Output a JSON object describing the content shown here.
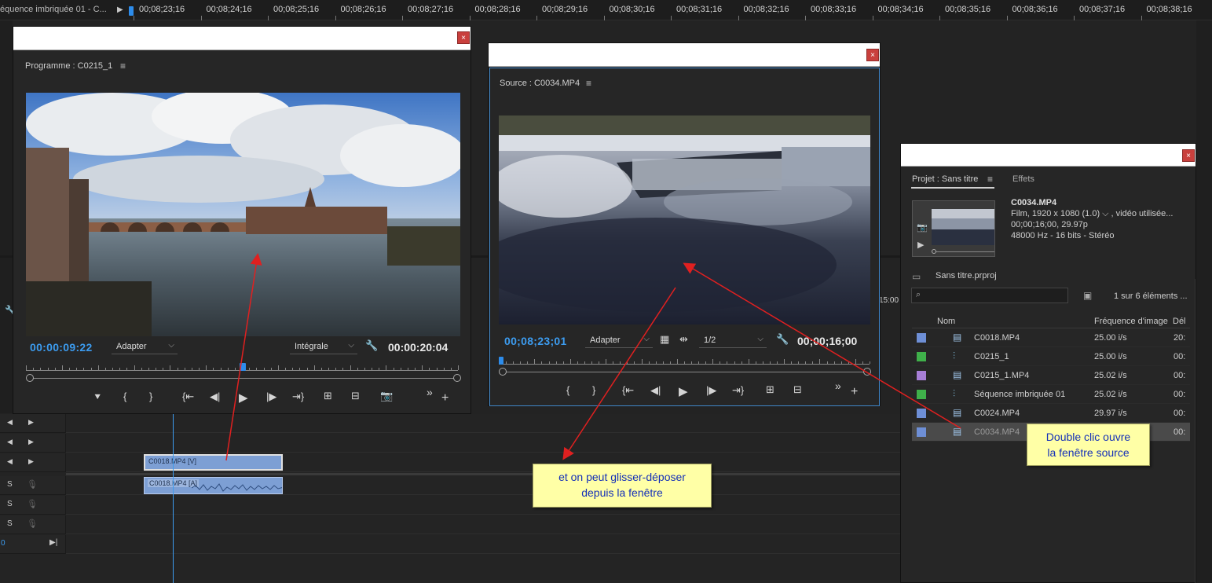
{
  "top_ruler": {
    "sequence_label": "équence imbriquée 01 - C...",
    "ticks": [
      "00;08;23;16",
      "00;08;24;16",
      "00;08;25;16",
      "00;08;26;16",
      "00;08;27;16",
      "00;08;28;16",
      "00;08;29;16",
      "00;08;30;16",
      "00;08;31;16",
      "00;08;32;16",
      "00;08;33;16",
      "00;08;34;16",
      "00;08;35;16",
      "00;08;36;16",
      "00;08;37;16",
      "00;08;38;16"
    ]
  },
  "program_monitor": {
    "title": "Programme : C0215_1",
    "close": "×",
    "menu": "≡",
    "current_timecode": "00:00:09:22",
    "fit_dropdown": "Adapter",
    "quality_dropdown": "Intégrale",
    "duration_timecode": "00:00:20:04",
    "more": "»",
    "add": "+",
    "playhead_fraction": 0.5
  },
  "source_monitor": {
    "title": "Source : C0034.MP4",
    "close": "×",
    "menu": "≡",
    "current_timecode": "00;08;23;01",
    "fit_dropdown": "Adapter",
    "resolution_dropdown": "1/2",
    "duration_timecode": "00;00;16;00",
    "more": "»",
    "add": "+",
    "playhead_fraction": 0.0
  },
  "project_panel": {
    "tab_project": "Projet : Sans titre",
    "tab_menu": "≡",
    "tab_effects": "Effets",
    "close": "×",
    "preview": {
      "name": "C0034.MP4",
      "line1": "Film, 1920 x 1080 (1.0) ⌵ , vidéo utilisée...",
      "line2": "00;00;16;00, 29.97p",
      "line3": "48000 Hz - 16  bits - Stéréo"
    },
    "project_file": "Sans titre.prproj",
    "search_placeholder": "",
    "item_count": "1 sur 6 éléments ...",
    "columns": {
      "name": "Nom",
      "framerate": "Fréquence d'image",
      "extra": "Dél"
    },
    "items": [
      {
        "name": "C0018.MP4",
        "framerate": "25.00 i/s",
        "extra": "20:",
        "color": "#6e8fd6",
        "type": "clip"
      },
      {
        "name": "C0215_1",
        "framerate": "25.00 i/s",
        "extra": "00:",
        "color": "#3fb04a",
        "type": "sequence"
      },
      {
        "name": "C0215_1.MP4",
        "framerate": "25.02 i/s",
        "extra": "00:",
        "color": "#a77ed6",
        "type": "clip"
      },
      {
        "name": "Séquence imbriquée 01",
        "framerate": "25.02 i/s",
        "extra": "00:",
        "color": "#3fb04a",
        "type": "sequence"
      },
      {
        "name": "C0024.MP4",
        "framerate": "29.97 i/s",
        "extra": "00:",
        "color": "#6e8fd6",
        "type": "clip"
      },
      {
        "name": "C0034.MP4",
        "framerate": "",
        "extra": "00:",
        "color": "#6e8fd6",
        "type": "clip",
        "selected": true
      }
    ]
  },
  "timeline": {
    "video_clip": "C0018.MP4 [V]",
    "audio_clip": "C0018.MP4 [A]",
    "s_labels": [
      "S",
      "S",
      "S"
    ],
    "left_digit": "0"
  },
  "misc": {
    "timecode_fragment": "15:00"
  },
  "callouts": {
    "drag": [
      "et on peut glisser-déposer",
      "depuis la fenêtre"
    ],
    "double_click": [
      "Double clic ouvre",
      "la fenêtre source"
    ]
  }
}
